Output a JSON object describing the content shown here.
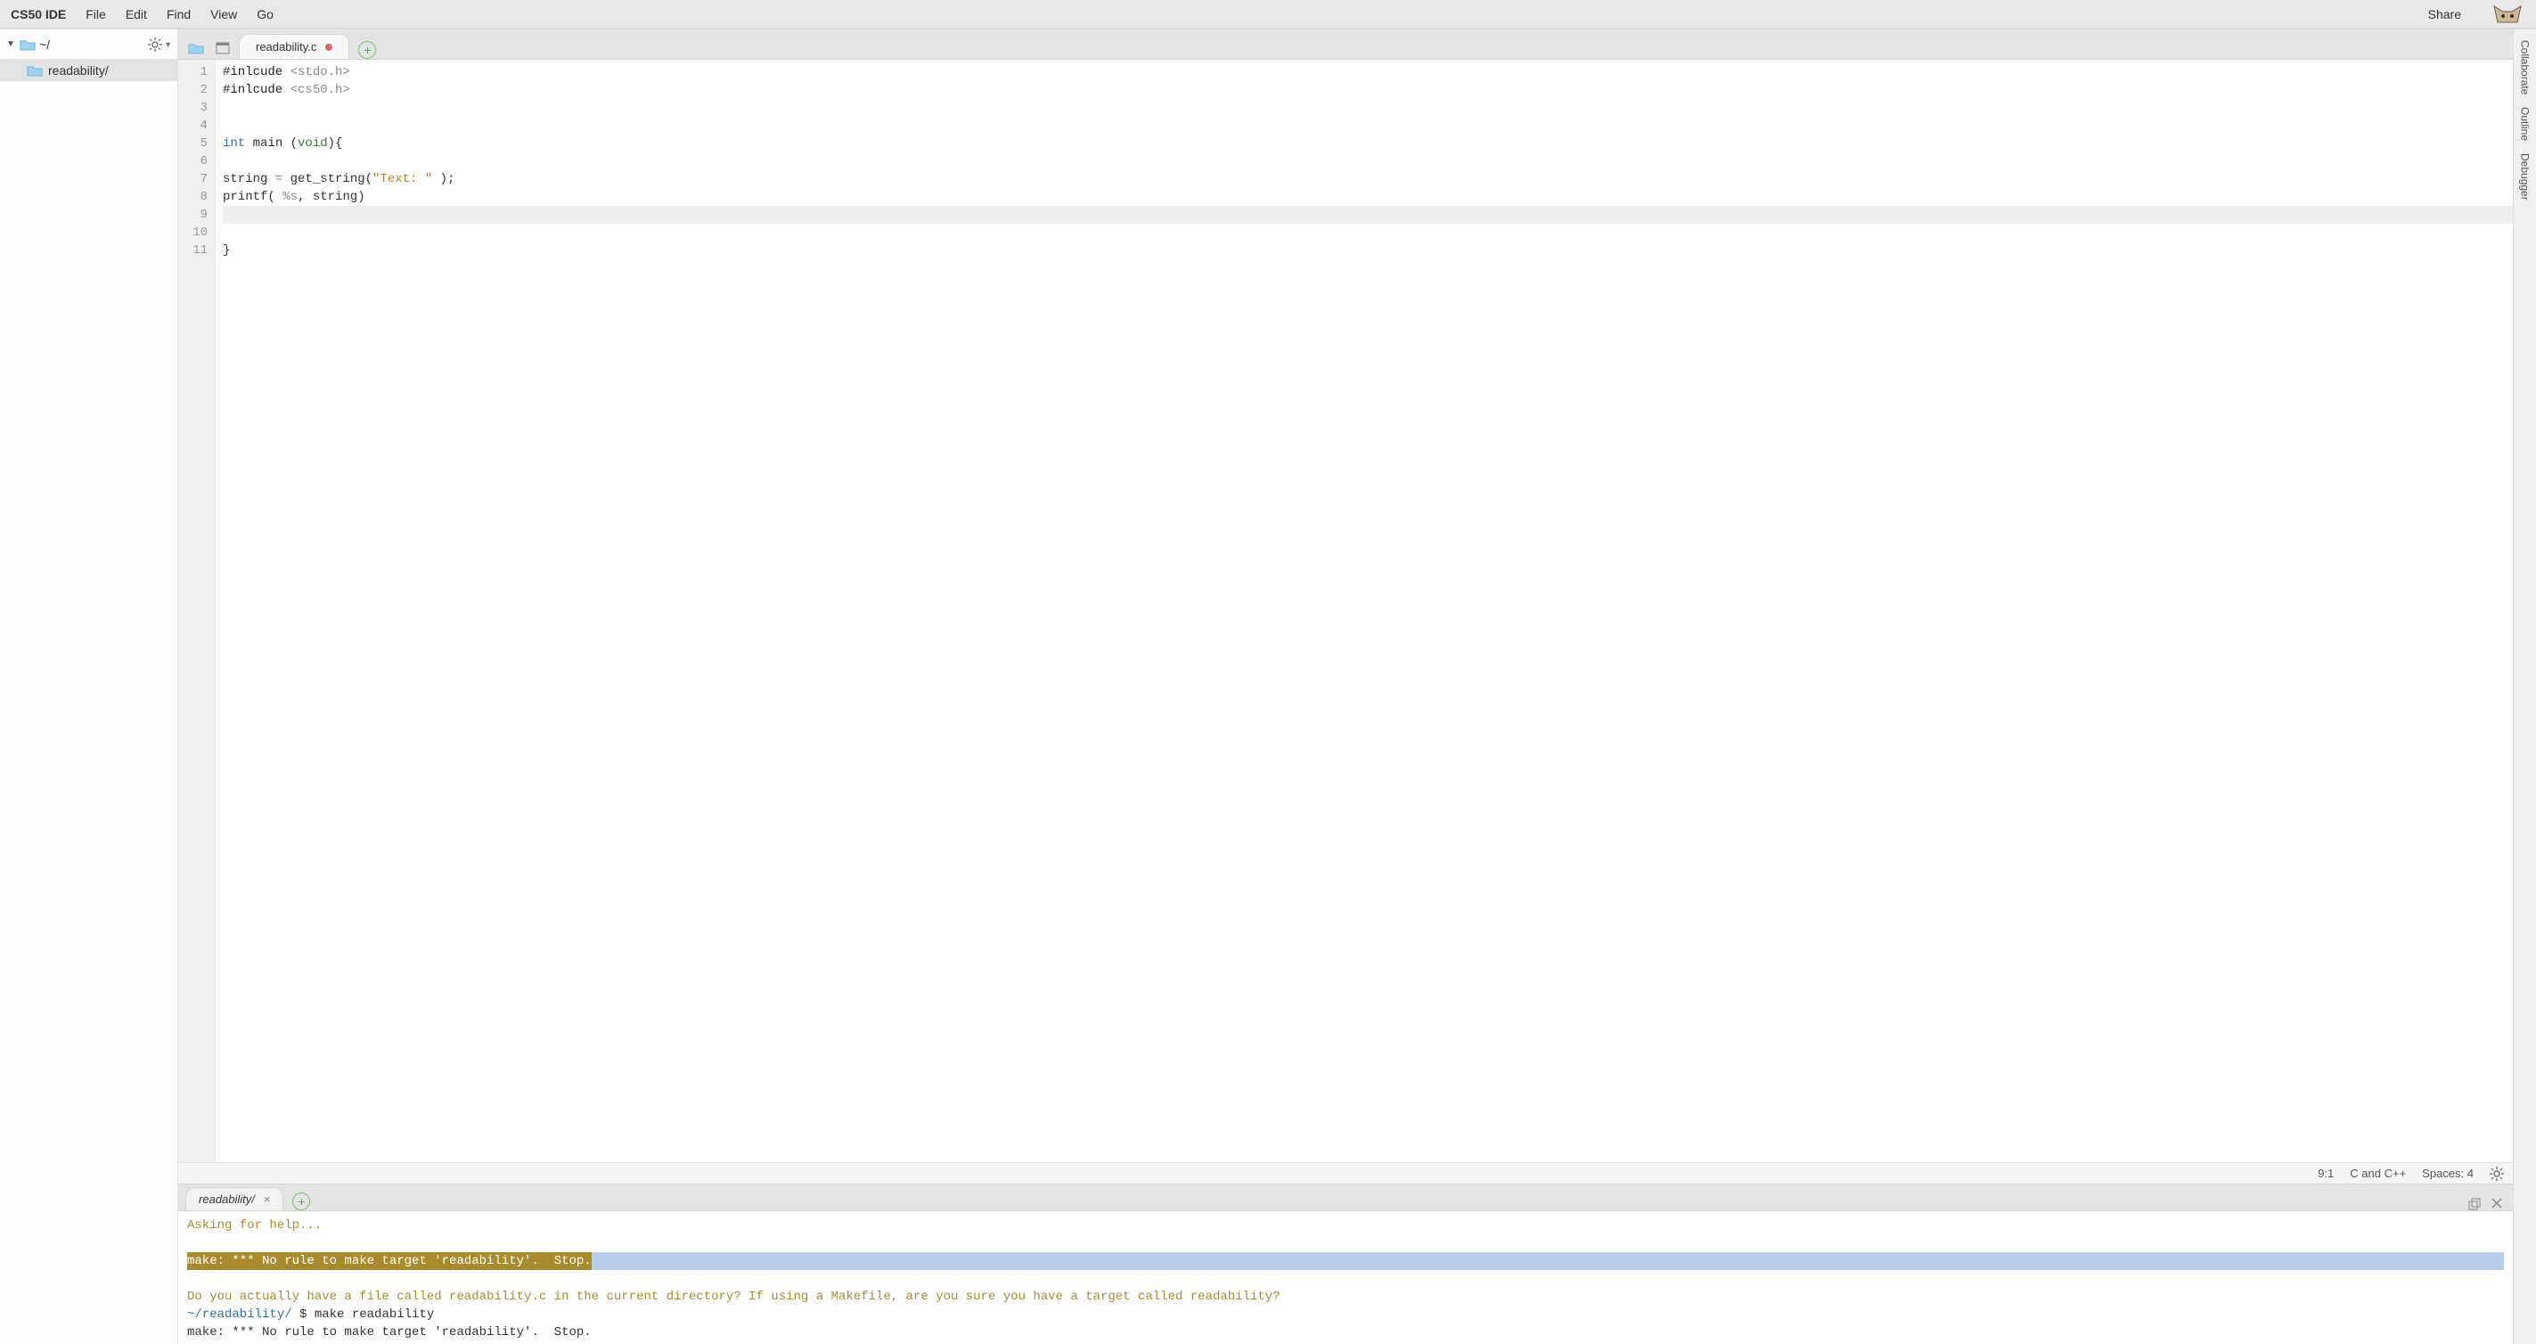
{
  "menubar": {
    "brand": "CS50 IDE",
    "items": [
      "File",
      "Edit",
      "Find",
      "View",
      "Go"
    ],
    "share": "Share"
  },
  "sidebar": {
    "root_label": "~/",
    "items": [
      {
        "label": "readability/"
      }
    ]
  },
  "editor_tabs": {
    "active": {
      "label": "readability.c",
      "dirty": true
    }
  },
  "editor": {
    "lines": [
      {
        "n": 1,
        "segments": [
          {
            "t": "#inlcude ",
            "c": "tok-pre"
          },
          {
            "t": "<stdo.h>",
            "c": "tok-op"
          }
        ]
      },
      {
        "n": 2,
        "segments": [
          {
            "t": "#inlcude ",
            "c": "tok-pre"
          },
          {
            "t": "<cs50.h>",
            "c": "tok-op"
          }
        ]
      },
      {
        "n": 3,
        "segments": []
      },
      {
        "n": 4,
        "segments": []
      },
      {
        "n": 5,
        "segments": [
          {
            "t": "int ",
            "c": "tok-kw"
          },
          {
            "t": "main (",
            "c": ""
          },
          {
            "t": "void",
            "c": "tok-void"
          },
          {
            "t": "){",
            "c": ""
          }
        ]
      },
      {
        "n": 6,
        "segments": []
      },
      {
        "n": 7,
        "segments": [
          {
            "t": "string ",
            "c": ""
          },
          {
            "t": "= ",
            "c": "tok-op"
          },
          {
            "t": "get_string(",
            "c": ""
          },
          {
            "t": "\"Text: \"",
            "c": "tok-str"
          },
          {
            "t": " );",
            "c": ""
          }
        ]
      },
      {
        "n": 8,
        "segments": [
          {
            "t": "printf( ",
            "c": ""
          },
          {
            "t": "%s",
            "c": "tok-op"
          },
          {
            "t": ", string)",
            "c": ""
          }
        ]
      },
      {
        "n": 9,
        "segments": [],
        "current": true
      },
      {
        "n": 10,
        "segments": []
      },
      {
        "n": 11,
        "segments": [
          {
            "t": "}",
            "c": ""
          }
        ]
      }
    ]
  },
  "status": {
    "cursor": "9:1",
    "lang": "C and C++",
    "tabs": "Spaces: 4"
  },
  "terminal": {
    "tab_label": "readability/",
    "lines": [
      {
        "class": "",
        "segments": [
          {
            "t": "Asking for help...",
            "c": "c-olive"
          }
        ]
      },
      {
        "class": "",
        "segments": [
          {
            "t": "",
            "c": ""
          }
        ]
      },
      {
        "class": "c-hl",
        "segments": [
          {
            "t": "make: *** No rule to make target 'readability'.  Stop.",
            "c": "bg-hl"
          }
        ]
      },
      {
        "class": "",
        "segments": [
          {
            "t": "",
            "c": ""
          }
        ]
      },
      {
        "class": "",
        "segments": [
          {
            "t": "Do you actually have a file called readability.c in the current directory? If using a Makefile, are you sure you have a target called readability?",
            "c": "c-olive"
          }
        ]
      },
      {
        "class": "",
        "segments": [
          {
            "t": "~/readability/",
            "c": "c-blue"
          },
          {
            "t": " $ make readability",
            "c": "c-text"
          }
        ]
      },
      {
        "class": "",
        "segments": [
          {
            "t": "make: *** No rule to make target 'readability'.  Stop.",
            "c": "c-text"
          }
        ]
      }
    ]
  },
  "panels": {
    "labels": [
      "Collaborate",
      "Outline",
      "Debugger"
    ]
  }
}
